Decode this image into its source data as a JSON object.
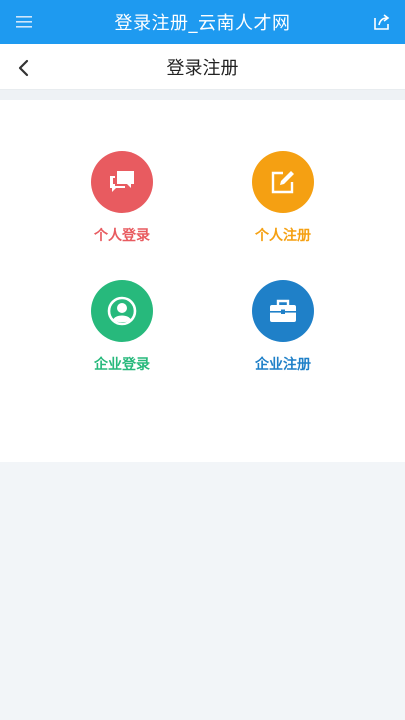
{
  "header": {
    "title": "登录注册_云南人才网",
    "menu_icon": "menu-icon",
    "share_icon": "share-icon",
    "color": "#1e9af0"
  },
  "nav": {
    "title": "登录注册",
    "back_icon": "chevron-left-icon"
  },
  "options": [
    {
      "label": "个人登录",
      "icon": "chat-bubbles-icon",
      "color": "#e85b60"
    },
    {
      "label": "个人注册",
      "icon": "edit-icon",
      "color": "#f5a012"
    },
    {
      "label": "企业登录",
      "icon": "user-circle-icon",
      "color": "#27b97c"
    },
    {
      "label": "企业注册",
      "icon": "briefcase-icon",
      "color": "#1f80c8"
    }
  ]
}
